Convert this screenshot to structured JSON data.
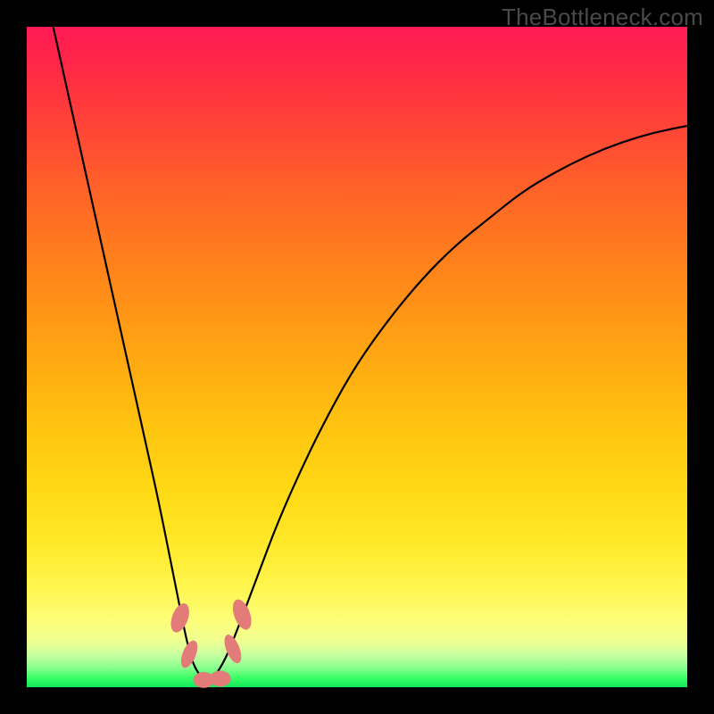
{
  "watermark": "TheBottleneck.com",
  "colors": {
    "frame": "#000000",
    "gradient_stops": [
      "#ff1a55",
      "#ff2846",
      "#ff4038",
      "#ff5a2c",
      "#ff7420",
      "#ff8c18",
      "#ffa812",
      "#ffc210",
      "#ffd814",
      "#ffe828",
      "#fff650",
      "#fdfe7a",
      "#f0ff90",
      "#c8ffa0",
      "#8cff90",
      "#3cff66",
      "#10e85a"
    ],
    "curve": "#000000",
    "blob": "#e37c78"
  },
  "chart_data": {
    "type": "line",
    "title": "",
    "xlabel": "",
    "ylabel": "",
    "xlim": [
      0,
      100
    ],
    "ylim": [
      0,
      100
    ],
    "series": [
      {
        "name": "bottleneck-curve",
        "x": [
          4,
          6,
          8,
          10,
          12,
          14,
          16,
          18,
          20,
          22,
          23,
          24,
          25,
          26,
          27,
          27.5,
          28,
          30,
          32,
          35,
          38,
          42,
          46,
          50,
          55,
          60,
          65,
          70,
          75,
          80,
          85,
          90,
          95,
          100
        ],
        "y": [
          100,
          91,
          82,
          73,
          64,
          55,
          46,
          37,
          28,
          18,
          13,
          8,
          4,
          2,
          1,
          0.7,
          1,
          4,
          9,
          17,
          25,
          34,
          42,
          49,
          56,
          62,
          67,
          71,
          75,
          78,
          80.5,
          82.5,
          84,
          85
        ]
      }
    ],
    "annotations": [
      {
        "name": "blob-left-upper",
        "x": 23.2,
        "y": 10.5,
        "rx": 1.2,
        "ry": 2.3,
        "rot": 20
      },
      {
        "name": "blob-left-lower",
        "x": 24.6,
        "y": 5.0,
        "rx": 1.0,
        "ry": 2.2,
        "rot": 22
      },
      {
        "name": "blob-bottom-1",
        "x": 26.8,
        "y": 1.1,
        "rx": 1.6,
        "ry": 1.2,
        "rot": 0
      },
      {
        "name": "blob-bottom-2",
        "x": 29.3,
        "y": 1.3,
        "rx": 1.6,
        "ry": 1.2,
        "rot": 0
      },
      {
        "name": "blob-right-lower",
        "x": 31.2,
        "y": 5.8,
        "rx": 1.0,
        "ry": 2.3,
        "rot": -22
      },
      {
        "name": "blob-right-upper",
        "x": 32.6,
        "y": 11.0,
        "rx": 1.2,
        "ry": 2.4,
        "rot": -20
      }
    ]
  }
}
